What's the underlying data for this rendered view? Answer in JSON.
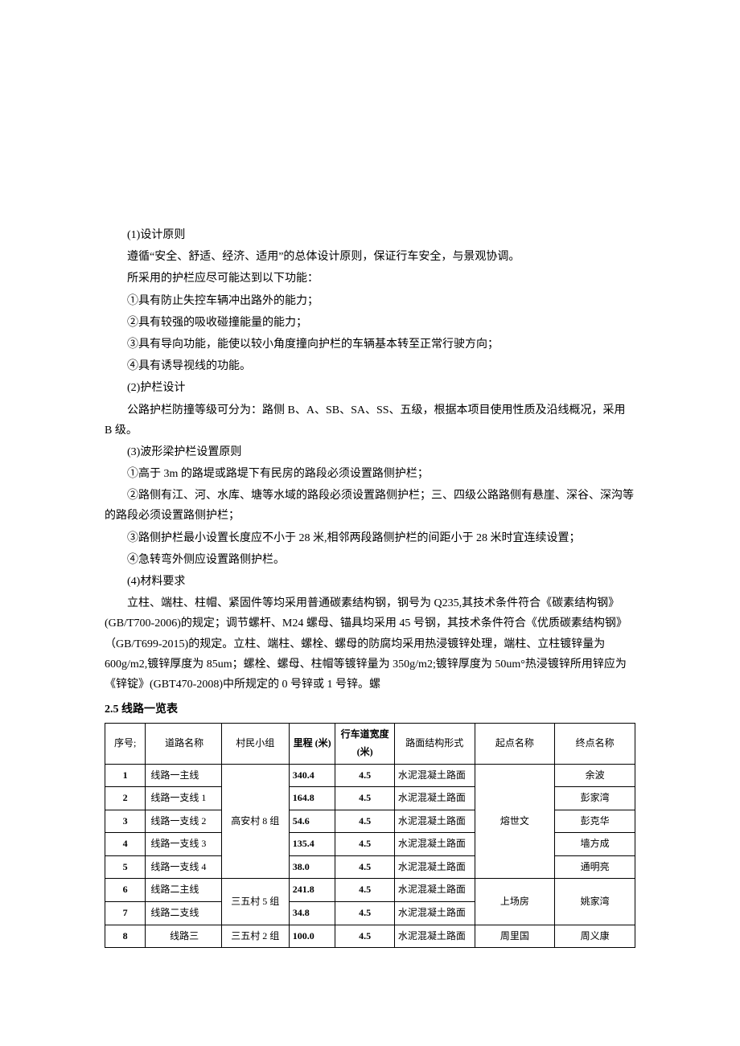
{
  "p1": "(1)设计原则",
  "p2": "遵循“安全、舒适、经济、适用”的总体设计原则，保证行车安全，与景观协调。",
  "p3": "所采用的护栏应尽可能达到以下功能：",
  "p4": "①具有防止失控车辆冲出路外的能力；",
  "p5": "②具有较强的吸收碰撞能量的能力；",
  "p6": "③具有导向功能，能使以较小角度撞向护栏的车辆基本转至正常行驶方向；",
  "p7": "④具有诱导视线的功能。",
  "p8": "(2)护栏设计",
  "p9": "公路护栏防撞等级可分为：路侧 B、A、SB、SA、SS、五级，根据本项目使用性质及沿线概况，采用 B 级。",
  "p10": "(3)波形梁护栏设置原则",
  "p11": "①高于 3m 的路堤或路堤下有民房的路段必须设置路侧护栏；",
  "p12": "②路侧有江、河、水库、塘等水域的路段必须设置路侧护栏；三、四级公路路侧有悬崖、深谷、深沟等的路段必须设置路侧护栏；",
  "p13": "③路侧护栏最小设置长度应不小于 28 米,相邻两段路侧护栏的间距小于 28 米时宜连续设置；",
  "p14": "④急转弯外侧应设置路侧护栏。",
  "p15": "(4)材料要求",
  "p16": "立柱、端柱、柱帽、紧固件等均采用普通碳素结构钢，钢号为 Q235,其技术条件符合《碳素结构钢》(GB/T700-2006)的规定；调节螺杆、M24 螺母、锚具均采用 45 号钢，其技术条件符合《优质碳素结构钢》（GB/T699-2015)的规定。立柱、端柱、螺栓、螺母的防腐均采用热浸镀锌处理，端柱、立柱镀锌量为 600g/m2,镀锌厚度为 85um；螺栓、螺母、柱帽等镀锌量为 350g/m2;镀锌厚度为 50um°热浸镀锌所用锌应为《锌锭》(GBT470-2008)中所规定的 0 号锌或 1 号锌。螺",
  "sectionTitle": "2.5 线路一览表",
  "headers": {
    "seq": "序号;",
    "road": "道路名称",
    "group": "村民小组",
    "dist": "里程\n(米)",
    "width": "行车道宽度\n(米)",
    "surf": "路面结构形式",
    "start": "起点名称",
    "end": "终点名称"
  },
  "rows": [
    {
      "seq": "1",
      "road": "线路一主线",
      "group": "高安村 8 组",
      "dist": "340.4",
      "width": "4.5",
      "surf": "水泥混凝土路面",
      "start": "熔世文",
      "end": "余波",
      "rs_group": 5,
      "rs_start": 5
    },
    {
      "seq": "2",
      "road": "线路一支线 1",
      "dist": "164.8",
      "width": "4.5",
      "surf": "水泥混凝土路面",
      "end": "彭家湾"
    },
    {
      "seq": "3",
      "road": "线路一支线 2",
      "dist": "54.6",
      "width": "4.5",
      "surf": "水泥混凝土路面",
      "end": "彭克华"
    },
    {
      "seq": "4",
      "road": "线路一支线 3",
      "dist": "135.4",
      "width": "4.5",
      "surf": "水泥混凝土路面",
      "end": "墙方成"
    },
    {
      "seq": "5",
      "road": "线路一支线 4",
      "dist": "38.0",
      "width": "4.5",
      "surf": "水泥混凝土路面",
      "end": "通明亮"
    },
    {
      "seq": "6",
      "road": "线路二主线",
      "group": "三五村 5 组",
      "dist": "241.8",
      "width": "4.5",
      "surf": "水泥混凝土路面",
      "start": "上场房",
      "end": "姚家湾",
      "rs_group": 2,
      "rs_start": 2,
      "rs_end": 2
    },
    {
      "seq": "7",
      "road": "线路二支线",
      "dist": "34.8",
      "width": "4.5",
      "surf": "水泥混凝土路面"
    },
    {
      "seq": "8",
      "road": "线路三",
      "group": "三五村 2 组",
      "dist": "100.0",
      "width": "4.5",
      "surf": "水泥混凝土路面",
      "start": "周里国",
      "end": "周义康",
      "roadCenter": true
    }
  ]
}
